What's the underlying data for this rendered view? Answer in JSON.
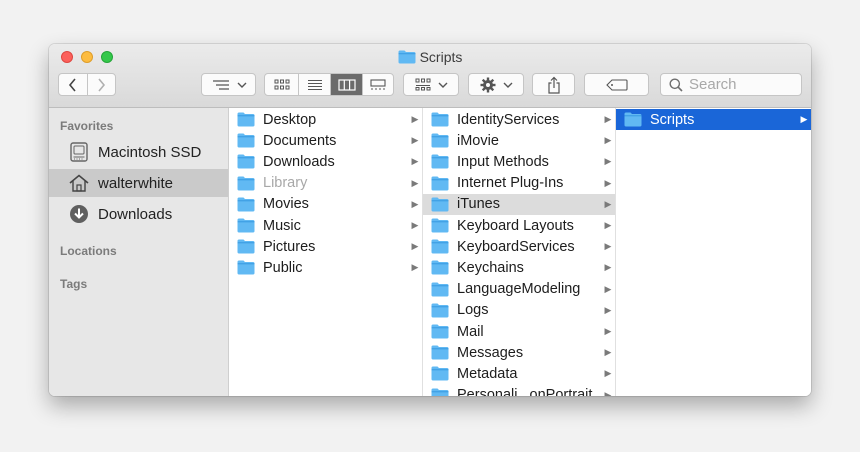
{
  "window": {
    "title": "Scripts"
  },
  "toolbar": {
    "back_icon": "chevron-left-icon",
    "forward_icon": "chevron-right-icon",
    "arrange_icon": "arrange-menu-icon",
    "view_modes": [
      "icon-view",
      "list-view",
      "column-view",
      "gallery-view"
    ],
    "active_view": "column-view",
    "group_icon": "group-by-icon",
    "action_icon": "gear-icon",
    "share_icon": "share-icon",
    "tag_icon": "tag-icon",
    "search_placeholder": "Search"
  },
  "sidebar": {
    "favorites_heading": "Favorites",
    "favorites": [
      {
        "label": "Macintosh SSD",
        "icon": "disk-icon"
      },
      {
        "label": "walterwhite",
        "icon": "home-icon",
        "selected": true
      },
      {
        "label": "Downloads",
        "icon": "downloads-icon"
      }
    ],
    "locations_heading": "Locations",
    "tags_heading": "Tags"
  },
  "columns": {
    "home": [
      {
        "label": "Desktop"
      },
      {
        "label": "Documents"
      },
      {
        "label": "Downloads"
      },
      {
        "label": "Library",
        "state": "dim"
      },
      {
        "label": "Movies"
      },
      {
        "label": "Music"
      },
      {
        "label": "Pictures"
      },
      {
        "label": "Public"
      }
    ],
    "library": [
      {
        "label": "IdentityServices"
      },
      {
        "label": "iMovie"
      },
      {
        "label": "Input Methods"
      },
      {
        "label": "Internet Plug-Ins"
      },
      {
        "label": "iTunes",
        "state": "hl"
      },
      {
        "label": "Keyboard Layouts"
      },
      {
        "label": "KeyboardServices"
      },
      {
        "label": "Keychains"
      },
      {
        "label": "LanguageModeling"
      },
      {
        "label": "Logs"
      },
      {
        "label": "Mail"
      },
      {
        "label": "Messages"
      },
      {
        "label": "Metadata"
      },
      {
        "label": "Personali...onPortrait"
      }
    ],
    "itunes": [
      {
        "label": "Scripts",
        "state": "sel"
      }
    ]
  },
  "colors": {
    "folder_fill": "#61b9f3",
    "folder_tab": "#42a2e6",
    "selection": "#1a66d8",
    "highlight": "#dcdcdc"
  }
}
